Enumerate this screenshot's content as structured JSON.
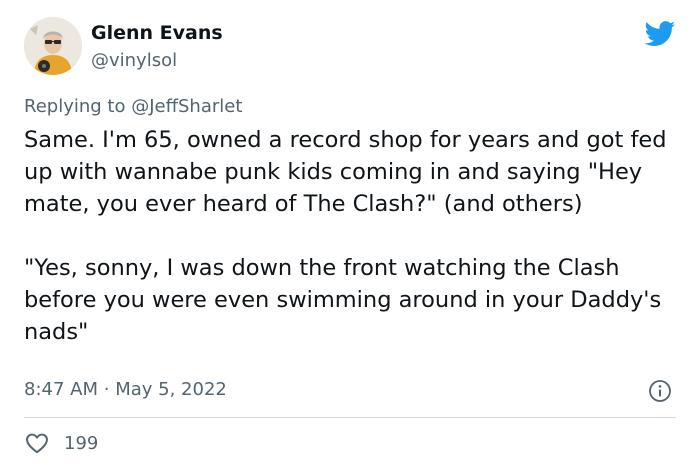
{
  "author": {
    "name": "Glenn Evans",
    "handle": "@vinylsol"
  },
  "reply": {
    "prefix": "Replying to",
    "mention": "@JeffSharlet"
  },
  "tweet": {
    "paragraphs": [
      "Same. I'm 65, owned a record shop for years and got fed up with wannabe punk kids coming in and saying \"Hey mate, you ever heard of The Clash?\" (and others)",
      "\"Yes, sonny, I was down the front watching the Clash before you were even swimming around in your Daddy's nads\""
    ]
  },
  "meta": {
    "time": "8:47 AM",
    "separator": "·",
    "date": "May 5, 2022"
  },
  "engagement": {
    "likes": "199"
  },
  "icons": {
    "brand": "twitter-bird-icon",
    "info": "info-icon",
    "like": "heart-icon"
  },
  "colors": {
    "brand": "#1d9bf0",
    "text": "#0f1419",
    "secondary": "#536471",
    "divider": "#cfd9de"
  }
}
